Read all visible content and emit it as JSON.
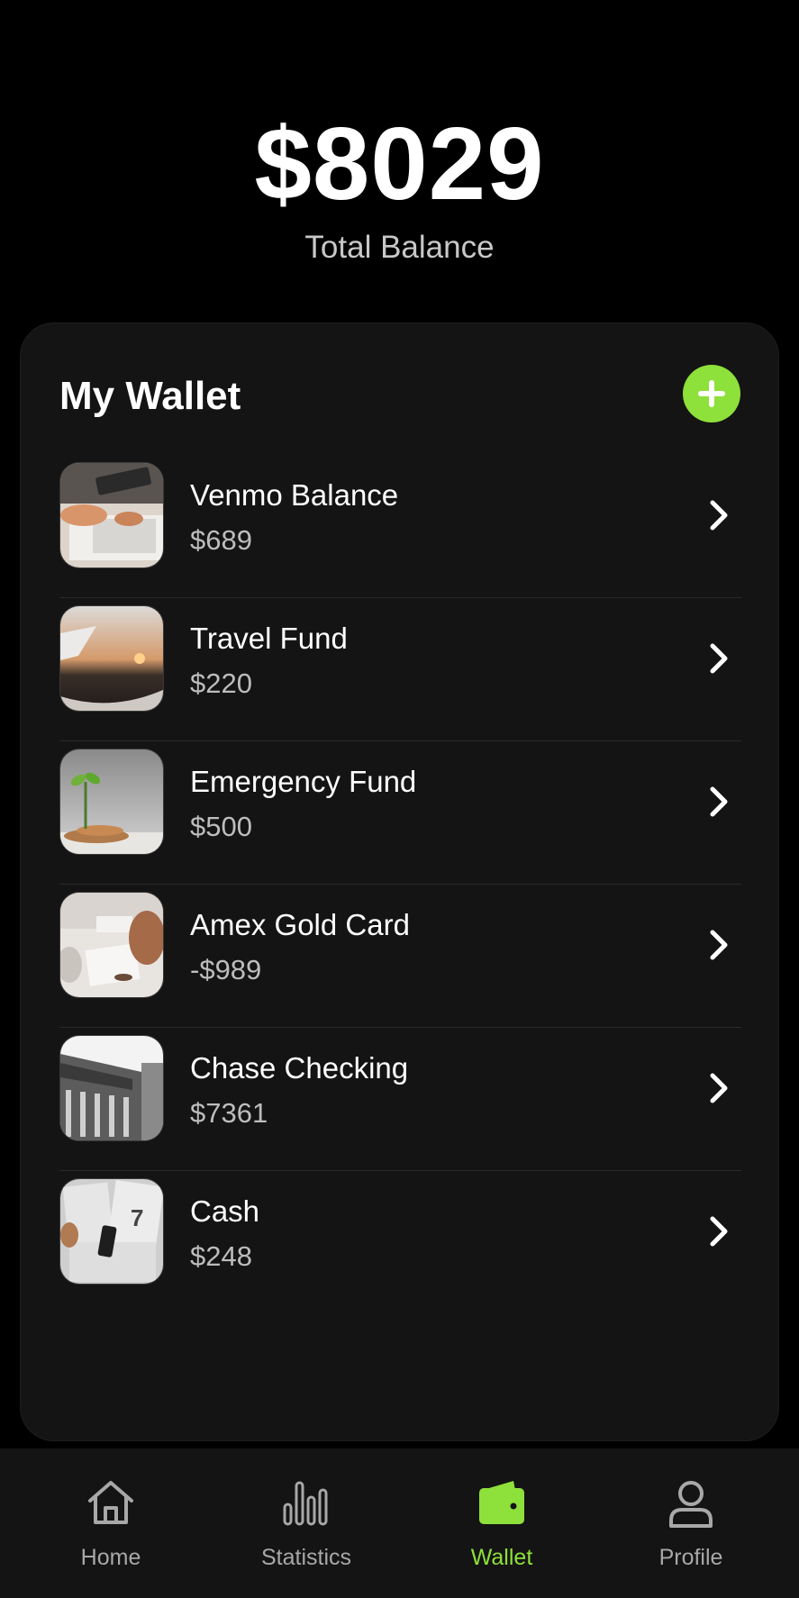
{
  "balance": {
    "amount": "$8029",
    "label": "Total Balance"
  },
  "wallet": {
    "title": "My Wallet",
    "add_icon": "plus-icon",
    "accounts": [
      {
        "name": "Venmo Balance",
        "amount": "$689",
        "thumb": "hands-on-laptop-photo"
      },
      {
        "name": "Travel Fund",
        "amount": "$220",
        "thumb": "airplane-window-sunset-photo"
      },
      {
        "name": "Emergency Fund",
        "amount": "$500",
        "thumb": "sprout-coins-photo"
      },
      {
        "name": "Amex Gold Card",
        "amount": "-$989",
        "thumb": "desk-paperwork-photo"
      },
      {
        "name": "Chase Checking",
        "amount": "$7361",
        "thumb": "bank-building-photo"
      },
      {
        "name": "Cash",
        "amount": "$248",
        "thumb": "receipts-paperwork-photo"
      }
    ]
  },
  "nav": {
    "items": [
      {
        "label": "Home",
        "icon": "home-icon",
        "active": false
      },
      {
        "label": "Statistics",
        "icon": "bar-chart-icon",
        "active": false
      },
      {
        "label": "Wallet",
        "icon": "wallet-icon",
        "active": true
      },
      {
        "label": "Profile",
        "icon": "user-icon",
        "active": false
      }
    ]
  },
  "colors": {
    "accent": "#8ee03a",
    "background": "#000000",
    "card": "#141414",
    "text_secondary": "#bdbdbd"
  }
}
